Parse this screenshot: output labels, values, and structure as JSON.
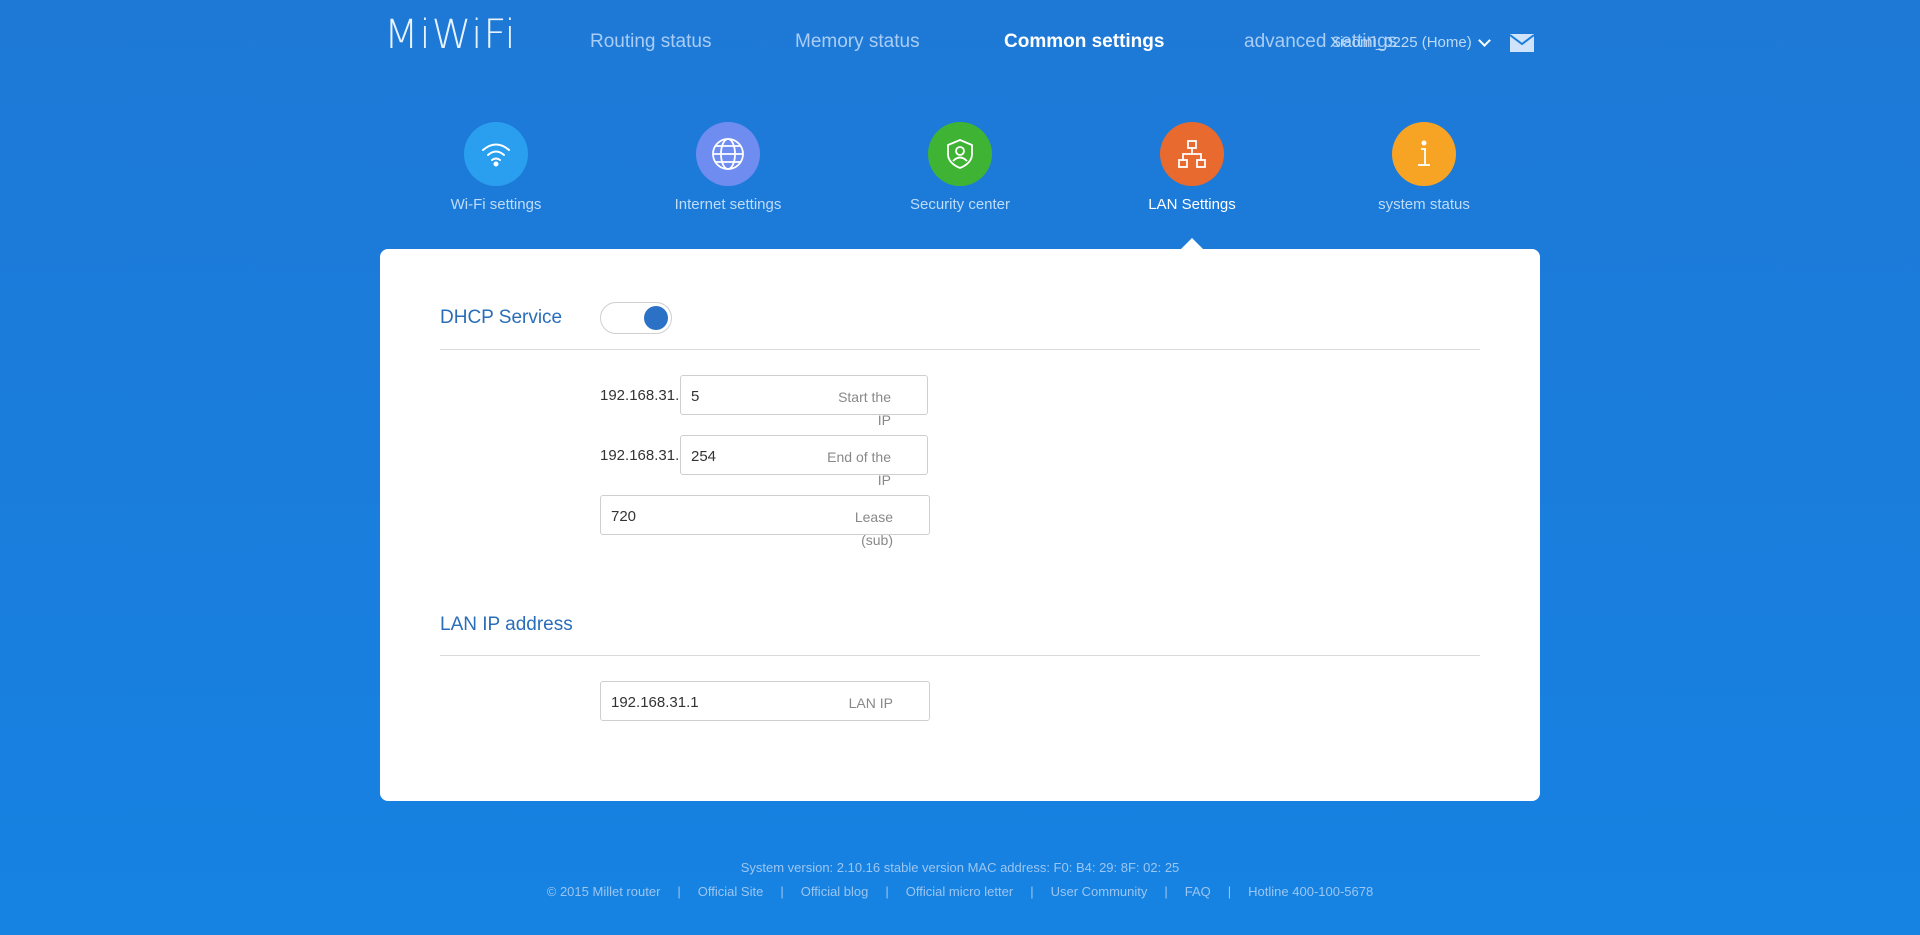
{
  "header": {
    "logo": "MiWiFi",
    "nav": [
      {
        "label": "Routing status",
        "active": false
      },
      {
        "label": "Memory status",
        "active": false
      },
      {
        "label": "Common settings",
        "active": true
      },
      {
        "label": "advanced settings",
        "active": false
      }
    ],
    "router_name": "Xiaomi_0225 (Home)",
    "mail_icon": "mail-icon"
  },
  "settings_icons": [
    {
      "label": "Wi-Fi settings",
      "icon": "wifi-icon",
      "color": "#2a9ff0",
      "active": false
    },
    {
      "label": "Internet settings",
      "icon": "globe-icon",
      "color": "#6f8cf0",
      "active": false
    },
    {
      "label": "Security center",
      "icon": "shield-icon",
      "color": "#3fb434",
      "active": false
    },
    {
      "label": "LAN Settings",
      "icon": "network-icon",
      "color": "#e86a2e",
      "active": true
    },
    {
      "label": "system status",
      "icon": "info-icon",
      "color": "#f7a425",
      "active": false
    }
  ],
  "dhcp": {
    "title": "DHCP Service",
    "enabled": true,
    "prefix": "192.168.31.",
    "start_ip": {
      "value": "5",
      "hint_line1": "Start the",
      "hint_line2": "IP"
    },
    "end_ip": {
      "value": "254",
      "hint_line1": "End of the",
      "hint_line2": "IP"
    },
    "lease": {
      "value": "720",
      "hint_line1": "Lease",
      "hint_line2": "(sub)"
    }
  },
  "lan": {
    "title": "LAN IP address",
    "ip": {
      "value": "192.168.31.1",
      "hint": "LAN IP"
    }
  },
  "footer": {
    "version_line": "System version: 2.10.16 stable version MAC address: F0: B4: 29: 8F: 02: 25",
    "copyright": "© 2015 Millet router",
    "links": [
      "Official Site",
      "Official blog",
      "Official micro letter",
      "User Community",
      "FAQ",
      "Hotline 400-100-5678"
    ]
  },
  "colors": {
    "background": "#1a7ddc",
    "accent": "#2a6db9",
    "toggle_on": "#2b72c7"
  }
}
